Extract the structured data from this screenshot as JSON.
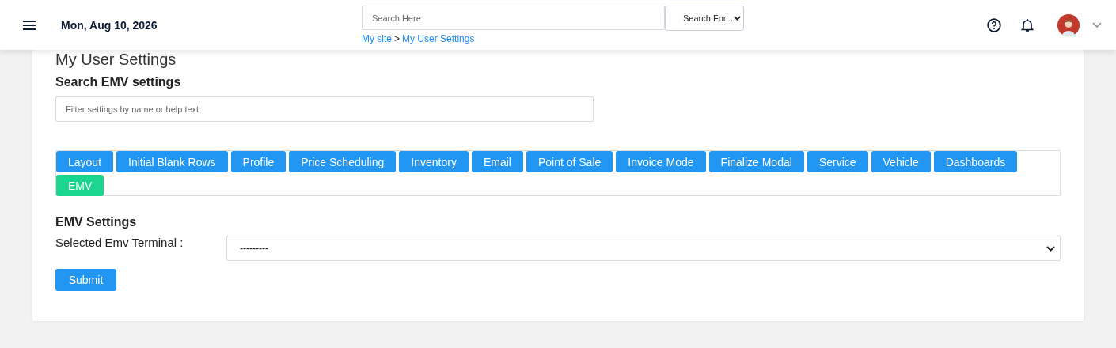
{
  "header": {
    "date": "Mon, Aug 10, 2026",
    "search": {
      "placeholder": "Search Here"
    },
    "search_scope": "Search For...",
    "breadcrumb": [
      "My site",
      "My User Settings"
    ],
    "breadcrumb_separator": ">"
  },
  "page": {
    "title": "My User Settings",
    "search_heading": "Search EMV settings",
    "filter": {
      "placeholder": "Filter settings by name or help text"
    }
  },
  "tabs": [
    {
      "label": "Layout",
      "selected": false
    },
    {
      "label": "Initial Blank Rows",
      "selected": false
    },
    {
      "label": "Profile",
      "selected": false
    },
    {
      "label": "Price Scheduling",
      "selected": false
    },
    {
      "label": "Inventory",
      "selected": false
    },
    {
      "label": "Email",
      "selected": false
    },
    {
      "label": "Point of Sale",
      "selected": false
    },
    {
      "label": "Invoice Mode",
      "selected": false
    },
    {
      "label": "Finalize Modal",
      "selected": false
    },
    {
      "label": "Service",
      "selected": false
    },
    {
      "label": "Vehicle",
      "selected": false
    },
    {
      "label": "Dashboards",
      "selected": false
    },
    {
      "label": "EMV",
      "selected": true
    }
  ],
  "section": {
    "title": "EMV Settings",
    "field_label": "Selected Emv Terminal :",
    "field_value": "---------",
    "submit": "Submit"
  }
}
